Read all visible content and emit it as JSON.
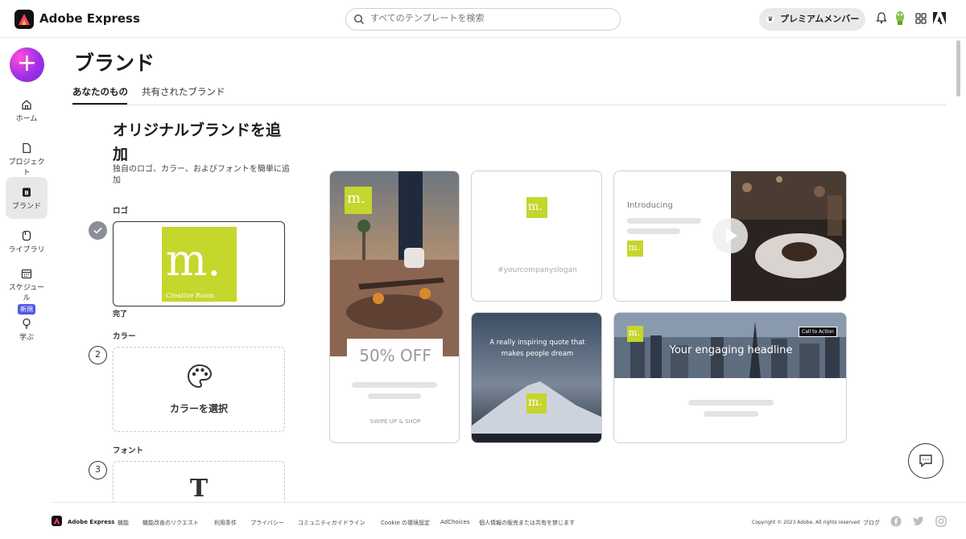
{
  "app": {
    "name": "Adobe Express"
  },
  "search": {
    "placeholder": "すべてのテンプレートを検索"
  },
  "header": {
    "premium_label": "プレミアムメンバー"
  },
  "sidebar": {
    "items": [
      {
        "label": "ホーム"
      },
      {
        "label": "プロジェクト"
      },
      {
        "label": "ブランド"
      },
      {
        "label": "ライブラリ"
      },
      {
        "label": "スケジュール",
        "badge": "新規"
      },
      {
        "label": "学ぶ"
      }
    ]
  },
  "page": {
    "title": "ブランド",
    "tabs": [
      {
        "label": "あなたのもの"
      },
      {
        "label": "共有されたブランド"
      }
    ],
    "heading": "オリジナルブランドを追加",
    "subheading": "独自のロゴ、カラー、およびフォントを簡単に追加",
    "sections": {
      "logo_label": "ロゴ",
      "logo_text": "m.",
      "logo_caption": "Creative Room",
      "logo_done": "完了",
      "color_label": "カラー",
      "color_step": "2",
      "color_action": "カラーを選択",
      "font_label": "フォント",
      "font_step": "3",
      "font_glyph": "T"
    }
  },
  "previews": {
    "logo_mark": "m.",
    "offer_text": "50% OFF",
    "swipe_text": "SWIPE UP & SHOP",
    "slogan": "#yourcompanyslogan",
    "introducing": "Introducing",
    "quote": "A really inspiring quote that makes people dream",
    "headline": "Your engaging headline",
    "cta": "Call to Action"
  },
  "footer": {
    "brand": "Adobe Express",
    "links": [
      "機能",
      "機能改善のリクエスト",
      "利用条件",
      "プライバシー",
      "コミュニティガイドライン",
      "Cookie の環境設定",
      "AdChoices",
      "個人情報の販売または共有を禁じます"
    ],
    "copyright": "Copyright © 2023 Adobe. All rights reserved",
    "blog": "ブログ"
  },
  "colors": {
    "brand_green": "#c5d62c",
    "accent": "#5258e4"
  }
}
